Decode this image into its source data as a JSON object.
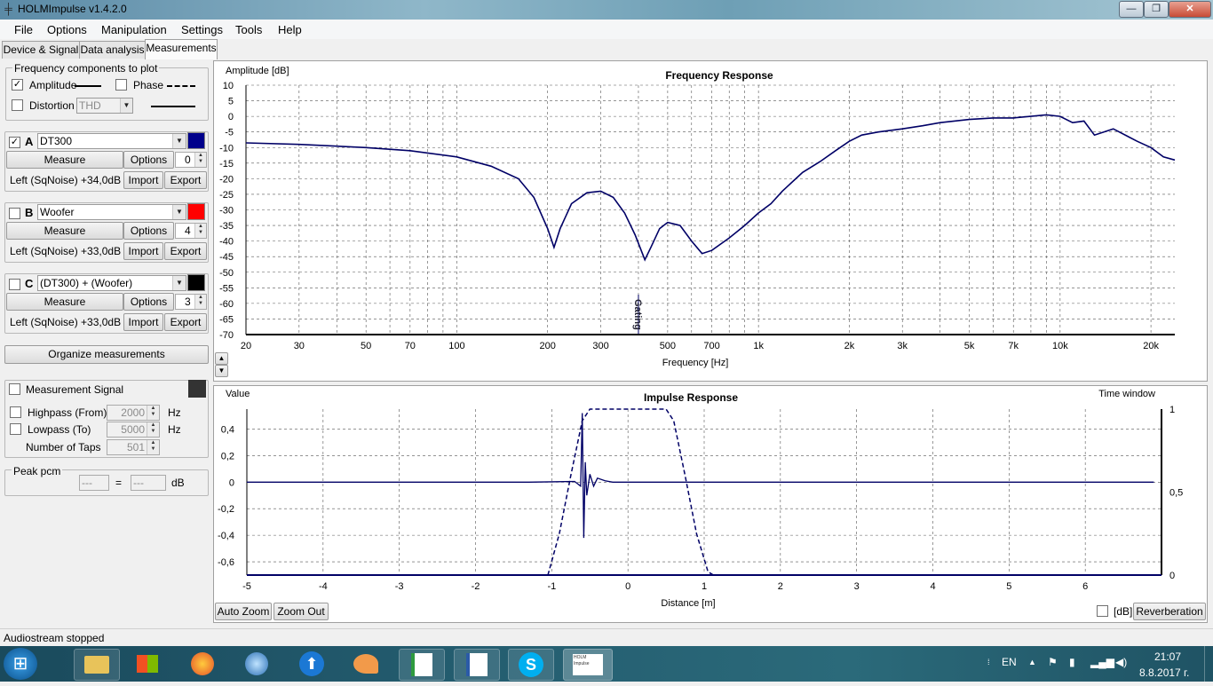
{
  "window": {
    "title": "HOLMImpulse  v1.4.2.0",
    "minimize": "—",
    "maximize": "❐",
    "close": "✕"
  },
  "menu": [
    "File",
    "Options",
    "Manipulation",
    "Settings",
    "Tools",
    "Help"
  ],
  "tabs": [
    "Device & Signal",
    "Data analysis",
    "Measurements"
  ],
  "freq_components": {
    "title": "Frequency components to plot",
    "amplitude": {
      "label": "Amplitude",
      "checked": true
    },
    "phase": {
      "label": "Phase",
      "checked": false
    },
    "distortion": {
      "label": "Distortion",
      "checked": false,
      "selected": "THD"
    }
  },
  "measurements": [
    {
      "letter": "A",
      "checked": true,
      "name": "DT300",
      "color": "#00008b",
      "measure": "Measure",
      "options": "Options",
      "spin": "0",
      "info": "Left (SqNoise) +34,0dB",
      "import": "Import",
      "export": "Export"
    },
    {
      "letter": "B",
      "checked": false,
      "name": "Woofer",
      "color": "#ff0000",
      "measure": "Measure",
      "options": "Options",
      "spin": "4",
      "info": "Left (SqNoise) +33,0dB",
      "import": "Import",
      "export": "Export"
    },
    {
      "letter": "C",
      "checked": false,
      "name": "(DT300) + (Woofer)",
      "color": "#000000",
      "measure": "Measure",
      "options": "Options",
      "spin": "3",
      "info": "Left (SqNoise) +33,0dB",
      "import": "Import",
      "export": "Export"
    }
  ],
  "organize_label": "Organize measurements",
  "signal": {
    "title": "Measurement Signal",
    "checked": false,
    "highpass": {
      "label": "Highpass (From)",
      "value": "2000",
      "unit": "Hz"
    },
    "lowpass": {
      "label": "Lowpass (To)",
      "value": "5000",
      "unit": "Hz"
    },
    "taps": {
      "label": "Number of Taps",
      "value": "501"
    }
  },
  "peak": {
    "title": "Peak pcm",
    "left": "---",
    "eq": "=",
    "right": "---",
    "unit": "dB"
  },
  "chart_data": [
    {
      "type": "line",
      "title": "Frequency Response",
      "ylabel": "Amplitude [dB]",
      "xlabel": "Frequency [Hz]",
      "x_scale": "log",
      "xlim": [
        20,
        24000
      ],
      "ylim": [
        -70,
        10
      ],
      "yticks": [
        10,
        5,
        0,
        -5,
        -10,
        -15,
        -20,
        -25,
        -30,
        -35,
        -40,
        -45,
        -50,
        -55,
        -60,
        -65,
        -70
      ],
      "ytick_labels": [
        "10",
        "5",
        "0",
        "-5",
        "-10",
        "-15",
        "-20",
        "-25",
        "-30",
        "-35",
        "-40",
        "-45",
        "-50",
        "-55",
        "-60",
        "-65",
        "-70"
      ],
      "xticks": [
        20,
        30,
        50,
        70,
        100,
        200,
        300,
        500,
        700,
        1000,
        2000,
        3000,
        5000,
        7000,
        10000,
        20000
      ],
      "xtick_labels": [
        "20",
        "30",
        "50",
        "70",
        "100",
        "200",
        "300",
        "500",
        "700",
        "1k",
        "2k",
        "3k",
        "5k",
        "7k",
        "10k",
        "20k"
      ],
      "annotation": {
        "text": "Gating",
        "x": 400
      },
      "grid": true,
      "color": "#000066",
      "x": [
        20,
        30,
        50,
        70,
        100,
        130,
        160,
        180,
        200,
        210,
        220,
        240,
        270,
        300,
        330,
        360,
        390,
        420,
        440,
        470,
        500,
        550,
        600,
        650,
        700,
        800,
        900,
        1000,
        1100,
        1200,
        1400,
        1600,
        1800,
        2000,
        2200,
        2500,
        3000,
        3500,
        4000,
        5000,
        6000,
        7000,
        8000,
        9000,
        10000,
        11000,
        12000,
        13000,
        15000,
        18000,
        20000,
        22000,
        24000
      ],
      "y": [
        -8.5,
        -9,
        -10,
        -11,
        -13,
        -16,
        -20,
        -26,
        -36,
        -42,
        -36,
        -28,
        -24.5,
        -24,
        -26,
        -31,
        -38,
        -46,
        -42,
        -36,
        -34,
        -35,
        -40,
        -44,
        -43,
        -39,
        -35,
        -31,
        -28,
        -24,
        -18,
        -14.5,
        -11,
        -8,
        -6,
        -5,
        -4,
        -3,
        -2,
        -1,
        -0.5,
        -0.5,
        0,
        0.5,
        0,
        -2,
        -1.5,
        -6,
        -4,
        -8,
        -10,
        -13,
        -14
      ]
    },
    {
      "type": "line",
      "title": "Impulse Response",
      "ylabel": "Value",
      "y2label": "Time window",
      "xlabel": "Distance [m]",
      "xlim": [
        -5,
        7
      ],
      "ylim": [
        -0.7,
        0.55
      ],
      "y2lim": [
        0,
        1
      ],
      "yticks": [
        0.4,
        0.2,
        0,
        -0.2,
        -0.4,
        -0.6
      ],
      "ytick_labels": [
        "0,4",
        "0,2",
        "0",
        "-0,2",
        "-0,4",
        "-0,6"
      ],
      "y2ticks": [
        1,
        0.5,
        0
      ],
      "y2tick_labels": [
        "1",
        "0,5",
        "0"
      ],
      "xticks": [
        -5,
        -4,
        -3,
        -2,
        -1,
        0,
        1,
        2,
        3,
        4,
        5,
        6
      ],
      "xtick_labels": [
        "-5",
        "-4",
        "-3",
        "-2",
        "-1",
        "0",
        "1",
        "2",
        "3",
        "4",
        "5",
        "6"
      ],
      "grid": true,
      "color": "#000066",
      "series": [
        {
          "name": "impulse",
          "style": "solid",
          "x": [
            -5,
            -1.3,
            -0.7,
            -0.62,
            -0.6,
            -0.58,
            -0.56,
            -0.54,
            -0.5,
            -0.45,
            -0.4,
            -0.3,
            -0.2,
            0,
            0.5,
            1,
            6.9
          ],
          "y": [
            0,
            0,
            0.005,
            -0.03,
            0.52,
            -0.42,
            0.15,
            -0.1,
            0.06,
            -0.03,
            0.03,
            0.01,
            0,
            0,
            0,
            0,
            0
          ]
        },
        {
          "name": "window",
          "style": "dashed",
          "axis": "y2",
          "x": [
            -1.05,
            -0.9,
            -0.75,
            -0.6,
            -0.5,
            0.5,
            0.6,
            0.75,
            0.9,
            1.05,
            1.12
          ],
          "y": [
            0,
            0.25,
            0.6,
            0.93,
            1,
            1,
            0.93,
            0.6,
            0.25,
            0.02,
            0
          ]
        }
      ]
    }
  ],
  "freq_controls": {
    "up": "▲",
    "down": "▼"
  },
  "impulse_controls": {
    "auto_zoom": "Auto Zoom",
    "zoom_out": "Zoom Out",
    "db_label": "[dB]",
    "db_checked": false,
    "reverberation": "Reverberation"
  },
  "status": "Audiostream stopped",
  "taskbar": {
    "start": "⊞",
    "language": "EN",
    "time": "21:07",
    "date": "8.8.2017 г.",
    "thumb_label": "HOLM Impulse"
  }
}
